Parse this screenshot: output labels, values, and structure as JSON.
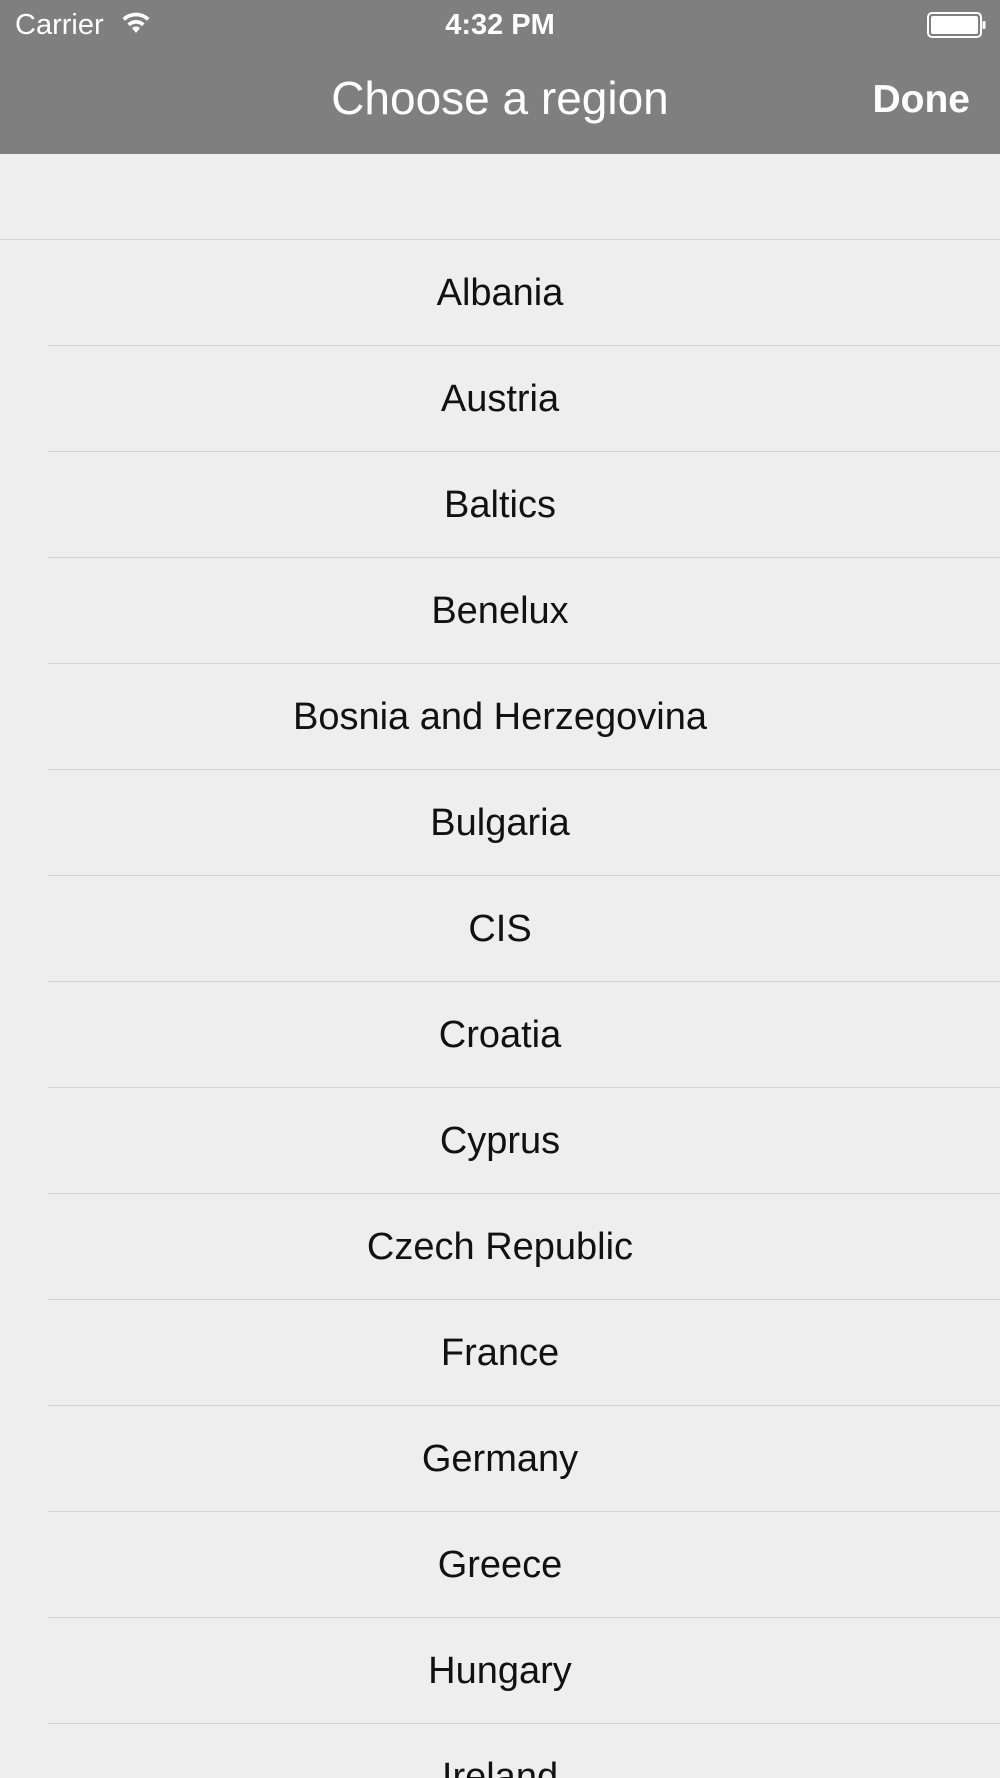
{
  "status_bar": {
    "carrier": "Carrier",
    "time": "4:32 PM",
    "icons": [
      "wifi-icon",
      "battery-icon"
    ]
  },
  "nav": {
    "title": "Choose a region",
    "done_label": "Done"
  },
  "colors": {
    "nav_background": "#7f7f7f",
    "list_background": "#efefef",
    "text": "#111111"
  },
  "regions": [
    {
      "label": "Albania"
    },
    {
      "label": "Austria"
    },
    {
      "label": "Baltics"
    },
    {
      "label": "Benelux"
    },
    {
      "label": "Bosnia and Herzegovina"
    },
    {
      "label": "Bulgaria"
    },
    {
      "label": "CIS"
    },
    {
      "label": "Croatia"
    },
    {
      "label": "Cyprus"
    },
    {
      "label": "Czech Republic"
    },
    {
      "label": "France"
    },
    {
      "label": "Germany"
    },
    {
      "label": "Greece"
    },
    {
      "label": "Hungary"
    },
    {
      "label": "Ireland"
    }
  ]
}
